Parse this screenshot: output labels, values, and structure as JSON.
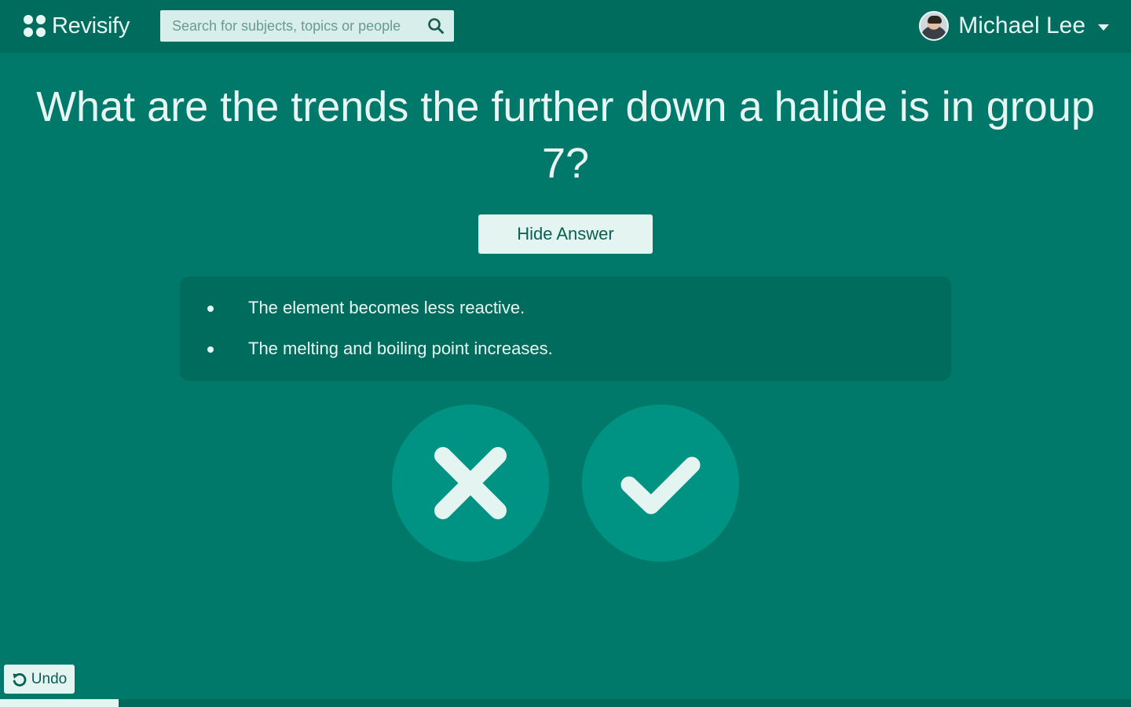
{
  "header": {
    "logo_text": "Revisify",
    "search": {
      "placeholder": "Search for subjects, topics or people",
      "value": ""
    },
    "user": {
      "name": "Michael Lee"
    }
  },
  "card": {
    "question": "What are the trends the further down a halide is in group 7?",
    "toggle_label": "Hide Answer",
    "answer_points": [
      "The element becomes less reactive.",
      "The melting and boiling point increases."
    ]
  },
  "actions": {
    "wrong_icon": "close-icon",
    "right_icon": "check-icon",
    "undo_label": "Undo"
  },
  "progress": {
    "fraction": 0.105
  },
  "colors": {
    "background": "#00796b",
    "header": "#006c5e",
    "accent_circle": "#009383",
    "light": "#e3f4f1"
  }
}
